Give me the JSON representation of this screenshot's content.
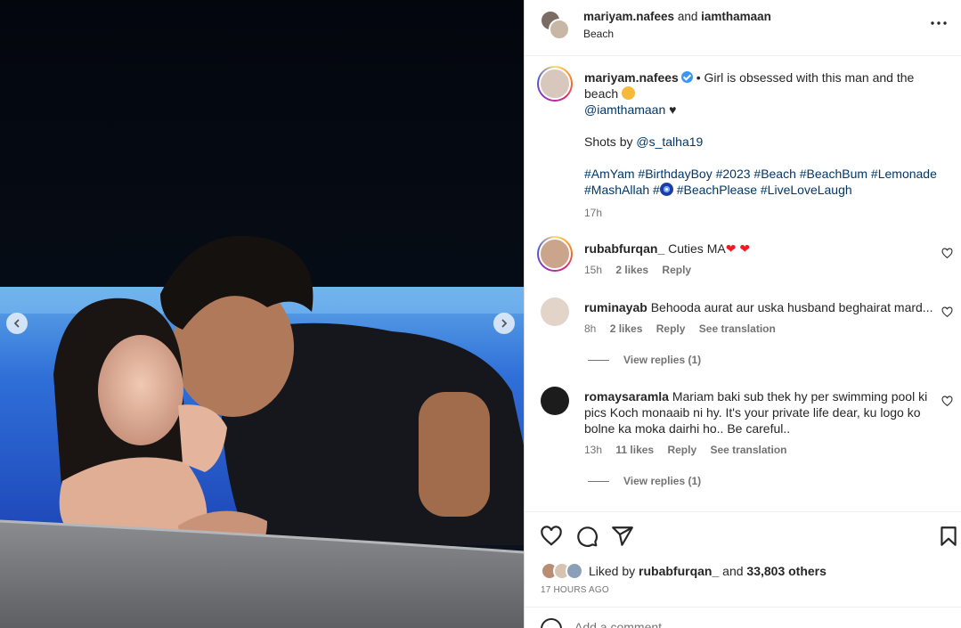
{
  "post": {
    "header": {
      "user1": "mariyam.nafees",
      "and": "and",
      "user2": "iamthamaan",
      "location": "Beach"
    },
    "caption": {
      "username": "mariyam.nafees",
      "text1": " • Girl is obsessed with this man and the beach ",
      "mention1": "@iamthamaan",
      "heart": " ♥",
      "shots_prefix": "Shots by ",
      "mention2": "@s_talha19",
      "hashtags_line1": "#AmYam #BirthdayBoy #2023 #Beach #BeachBum #Lemonade",
      "hashtags_line2a": "#MashAllah #",
      "hashtags_line2b": " #BeachPlease #LiveLoveLaugh",
      "time": "17h"
    },
    "comments": [
      {
        "username": "rubabfurqan_",
        "text": " Cuties MA",
        "hearts": "❤ ❤",
        "time": "15h",
        "likes": "2 likes",
        "reply": "Reply"
      },
      {
        "username": "ruminayab",
        "text": " Behooda aurat aur uska husband beghairat mard....",
        "time": "8h",
        "likes": "2 likes",
        "reply": "Reply",
        "translation": "See translation",
        "view_replies": "View replies (1)"
      },
      {
        "username": "romaysaramla",
        "text": " Mariam baki sub thek hy per swimming pool ki pics Koch monaaib ni hy. It's your private life dear, ku logo ko bolne ka moka dairhi ho.. Be careful..",
        "time": "13h",
        "likes": "11 likes",
        "reply": "Reply",
        "translation": "See translation",
        "view_replies": "View replies (1)"
      }
    ],
    "likes": {
      "prefix": "Liked by ",
      "user": "rubabfurqan_",
      "middle": " and ",
      "count": "33,803 others"
    },
    "post_time": "17 HOURS AGO",
    "add_comment_placeholder": "Add a comment..."
  },
  "icons": {
    "prev": "chevron-left-icon",
    "next": "chevron-right-icon",
    "more": "more-horizontal-icon",
    "like": "heart-icon",
    "comment": "comment-icon",
    "share": "share-icon",
    "save": "bookmark-icon",
    "emoji": "emoji-icon"
  },
  "colors": {
    "link": "#00376b",
    "verified": "#3897f0",
    "muted": "#737373",
    "text": "#262626"
  }
}
